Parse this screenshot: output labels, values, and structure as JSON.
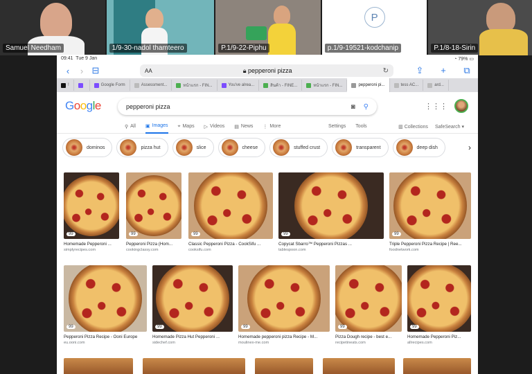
{
  "participants": [
    {
      "name": "Samuel Needham",
      "bg": "#2b2b2b"
    },
    {
      "name": "1/9-30-nadol thamteero",
      "bg": "#6fb7bd"
    },
    {
      "name": "P.1/9-22-Piphu",
      "bg": "#9a8e85"
    },
    {
      "name": "p.1/9-19521-kodchanip",
      "bg": "#ffffff",
      "initial": "P"
    },
    {
      "name": "P.1/8-18-Sirin",
      "bg": "#5a5a5a"
    }
  ],
  "statusbar": {
    "time": "09:41",
    "date": "Tue 9 Jan",
    "battery": "79%"
  },
  "browser": {
    "aa_label": "AA",
    "url": "pepperoni pizza",
    "tabs": [
      {
        "label": "!",
        "fav": "#111"
      },
      {
        "label": "",
        "fav": "#7c4dff"
      },
      {
        "label": "Google Form",
        "fav": "#7c4dff"
      },
      {
        "label": "Assessment...",
        "fav": "#bbb"
      },
      {
        "label": "หน้าแรก - FIN...",
        "fav": "#4caf50"
      },
      {
        "label": "You've alrea...",
        "fav": "#7c4dff"
      },
      {
        "label": "สินค้า - FINE...",
        "fav": "#4caf50"
      },
      {
        "label": "หน้าแรก - FIN...",
        "fav": "#4caf50"
      },
      {
        "label": "pepperoni pi...",
        "fav": "#999"
      },
      {
        "label": "tess AC...",
        "fav": "#bbb"
      },
      {
        "label": "ard...",
        "fav": "#bbb"
      }
    ]
  },
  "google": {
    "logo": "Google",
    "query": "pepperoni pizza",
    "nav": [
      "All",
      "Images",
      "Maps",
      "Videos",
      "News",
      "More"
    ],
    "nav_right": [
      "Settings",
      "Tools"
    ],
    "nav_far": [
      "Collections",
      "SafeSearch"
    ],
    "chips": [
      "dominos",
      "pizza hut",
      "slice",
      "cheese",
      "stuffed crust",
      "transparent",
      "deep dish"
    ],
    "results": [
      {
        "title": "Homemade Pepperoni ...",
        "src": "simplyrecipes.com"
      },
      {
        "title": "Pepperoni Pizza (Hom...",
        "src": "cookingclassy.com"
      },
      {
        "title": "Classic Pepperoni Pizza - CookSifu ...",
        "src": "cooksifu.com"
      },
      {
        "title": "Copycat Sbarro™ Pepperoni Pizzas ...",
        "src": "tablespoon.com"
      },
      {
        "title": "Triple Pepperoni Pizza Recipe | Ree...",
        "src": "foodnetwork.com"
      },
      {
        "title": "Pepperoni Pizza Recipe - Ooni Europe",
        "src": "eu.ooni.com"
      },
      {
        "title": "Homemade Pizza Hut Pepperoni ...",
        "src": "sidechef.com"
      },
      {
        "title": "Homemade pepperoni pizza Recipe - M...",
        "src": "moulinex-me.com"
      },
      {
        "title": "Pizza Dough recipe - best e...",
        "src": "recipetineats.com"
      },
      {
        "title": "Homemade Pepperoni Piz...",
        "src": "allrecipes.com"
      }
    ],
    "badge": "99"
  }
}
